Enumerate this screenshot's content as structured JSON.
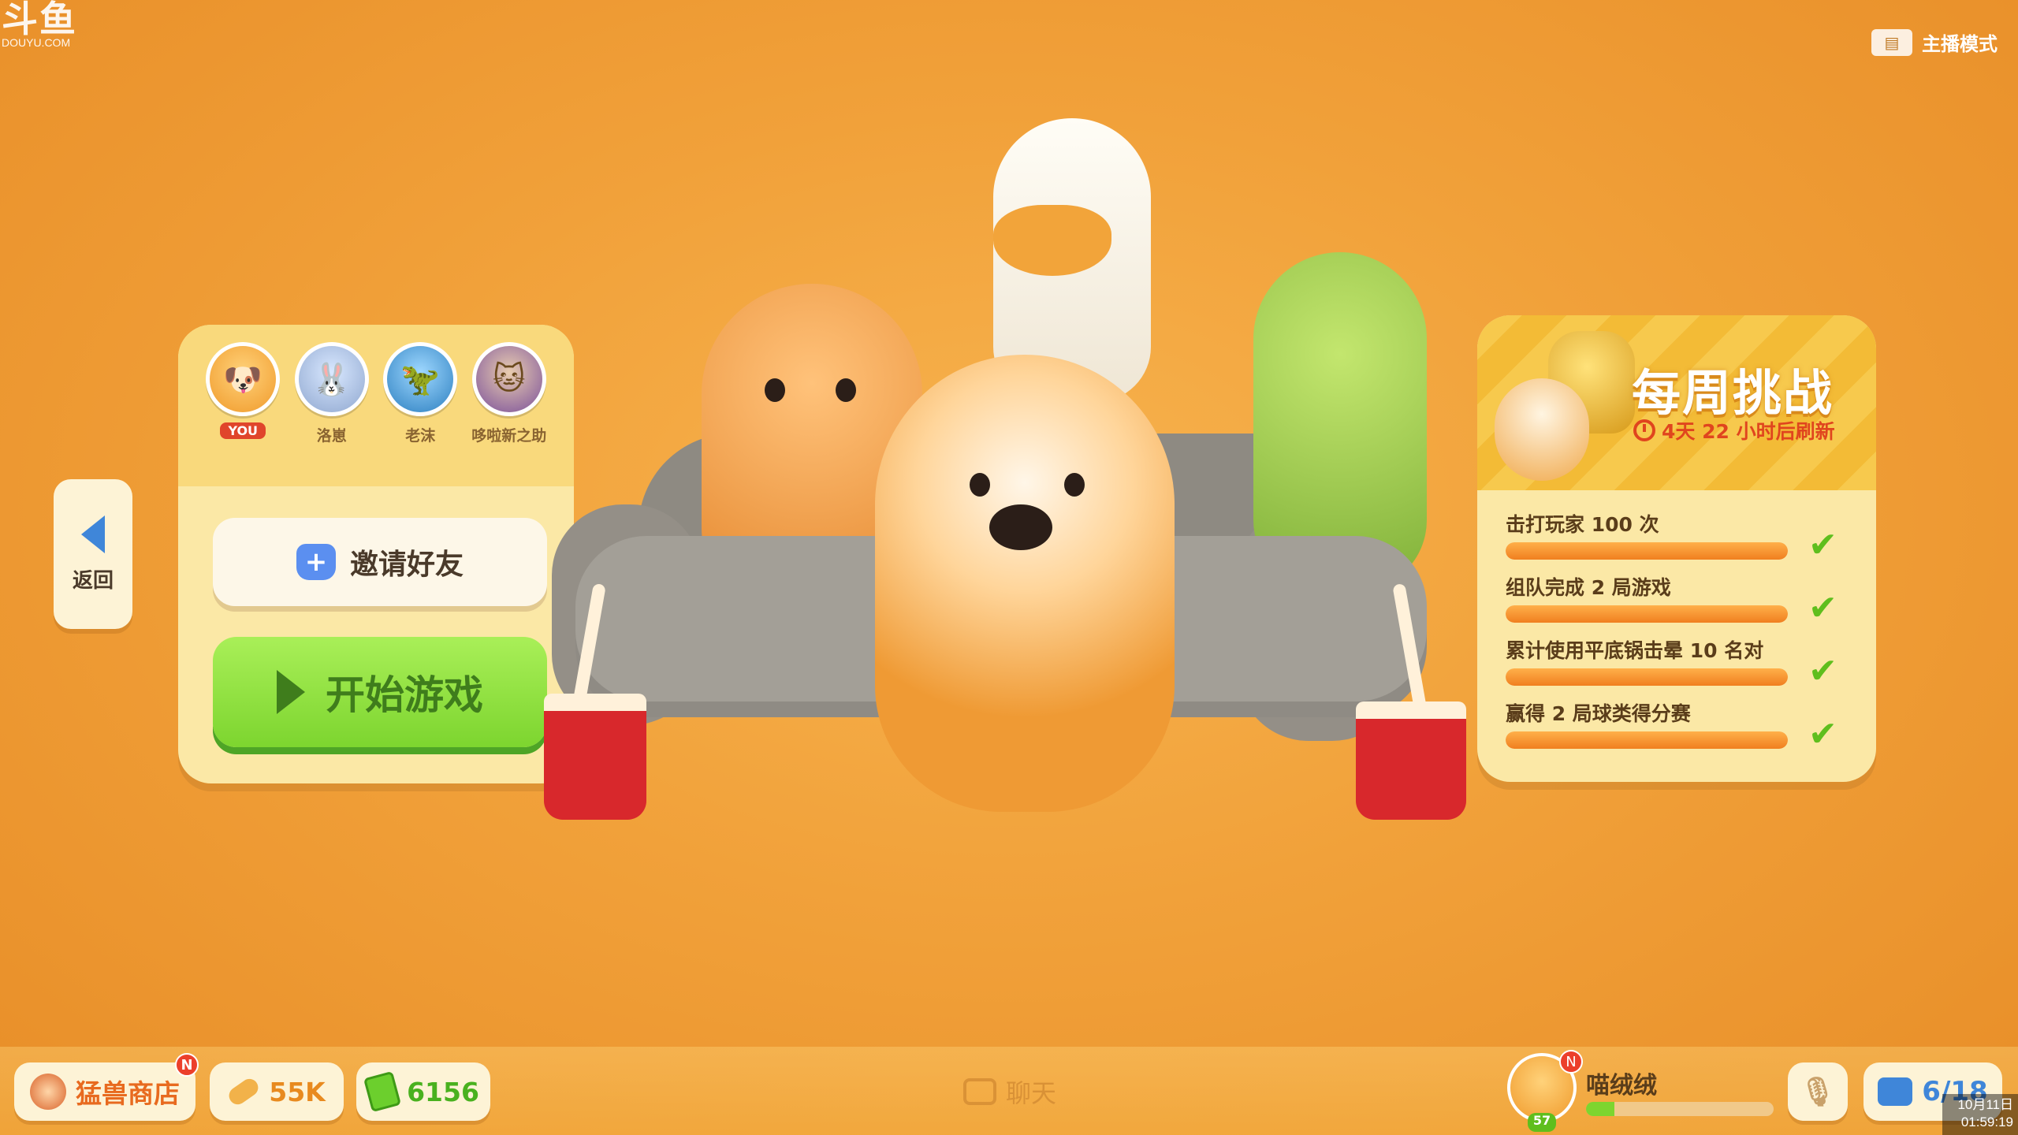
{
  "watermark": {
    "logo": "斗鱼",
    "domain": "DOUYU.COM"
  },
  "header": {
    "streamer_mode_label": "主播模式",
    "streamer_mode_icon": "id-card-icon"
  },
  "nav": {
    "back_label": "返回",
    "back_icon": "chevron-left-icon"
  },
  "team": {
    "members": [
      {
        "name": "",
        "badge": "YOU",
        "avatar_icon": "corgi-avatar"
      },
      {
        "name": "洛崽",
        "badge": "",
        "avatar_icon": "bunny-avatar"
      },
      {
        "name": "老沫",
        "badge": "",
        "avatar_icon": "dino-avatar"
      },
      {
        "name": "哆啦新之助",
        "badge": "",
        "avatar_icon": "cat-avatar"
      }
    ],
    "invite_label": "邀请好友",
    "start_label": "开始游戏"
  },
  "challenge": {
    "title": "每周挑战",
    "timer": "4天 22 小时后刷新",
    "tasks": [
      {
        "label": "击打玩家 100 次",
        "progress": 1.0,
        "completed": true
      },
      {
        "label": "组队完成 2 局游戏",
        "progress": 1.0,
        "completed": true
      },
      {
        "label": "累计使用平底锅击晕 10 名对",
        "progress": 1.0,
        "completed": true
      },
      {
        "label": "赢得 2 局球类得分赛",
        "progress": 1.0,
        "completed": true
      }
    ]
  },
  "footer": {
    "shop_label": "猛兽商店",
    "shop_badge": "N",
    "bones": "55K",
    "cash": "6156",
    "chat_label": "聊天",
    "player_name": "喵绒绒",
    "player_level": "57",
    "player_badge": "N",
    "player_xp": 0.15,
    "party_count": "6/18"
  },
  "system_clock": {
    "date": "10月11日",
    "time": "01:59:19"
  },
  "colors": {
    "accent_green": "#7dd52f",
    "accent_orange": "#f07f1f",
    "accent_blue": "#3f86d9",
    "badge_red": "#ec3f2b"
  }
}
